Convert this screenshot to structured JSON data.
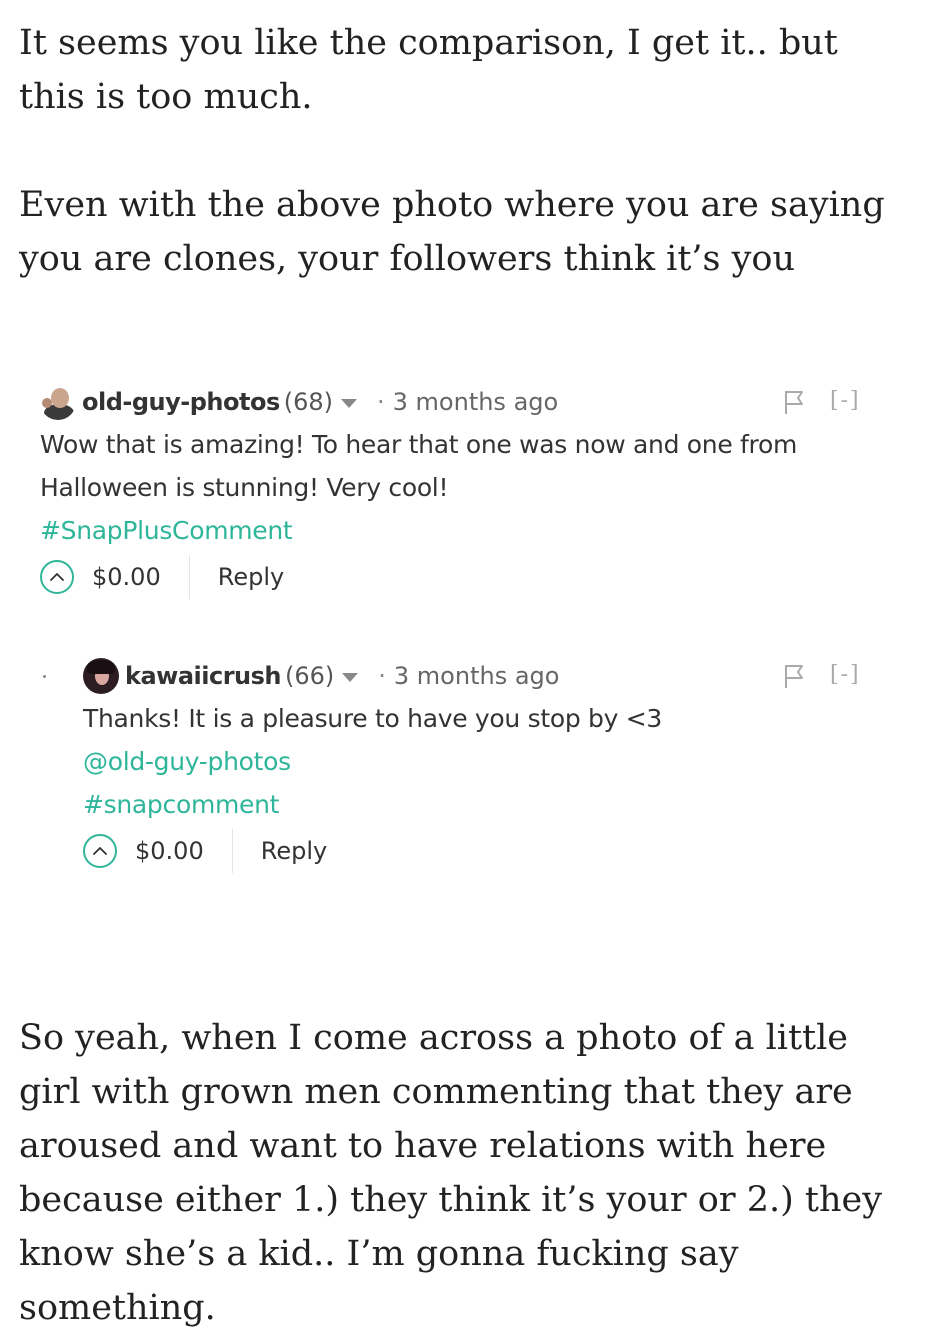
{
  "paragraphs": [
    "It seems you like the comparison, I get it.. but this is too much.",
    "Even with the above photo where you are saying you are clones, your followers think it’s you",
    "So yeah, when I come across a photo of a little girl with grown men commenting that they are aroused and want to have relations with here because either 1.) they think it’s your or 2.) they know she’s a kid.. I’m gonna fucking say something."
  ],
  "comments": [
    {
      "username": "old-guy-photos",
      "reputation": "(68)",
      "separator": "·",
      "time": "3 months ago",
      "collapse": "[-]",
      "body": "Wow that is amazing! To hear that one was now and one from Halloween is stunning! Very cool!",
      "mention": "",
      "hashtag": "#SnapPlusComment",
      "payout": "$0.00",
      "reply_label": "Reply"
    },
    {
      "username": "kawaiicrush",
      "reputation": "(66)",
      "separator": "·",
      "time": "3 months ago",
      "collapse": "[-]",
      "body": "Thanks! It is a pleasure to have you stop by <3",
      "mention": "@old-guy-photos",
      "hashtag": "#snapcomment",
      "payout": "$0.00",
      "reply_label": "Reply"
    }
  ],
  "icons": {
    "avatar_1": "avatar-old-guy-photos",
    "avatar_2": "avatar-kawaiicrush",
    "flag": "flag-icon",
    "upvote": "upvote-chevron-icon",
    "dropdown": "caret-down-icon"
  },
  "colors": {
    "accent": "#2fb69a",
    "text": "#333333",
    "muted": "#aaaaaa"
  }
}
